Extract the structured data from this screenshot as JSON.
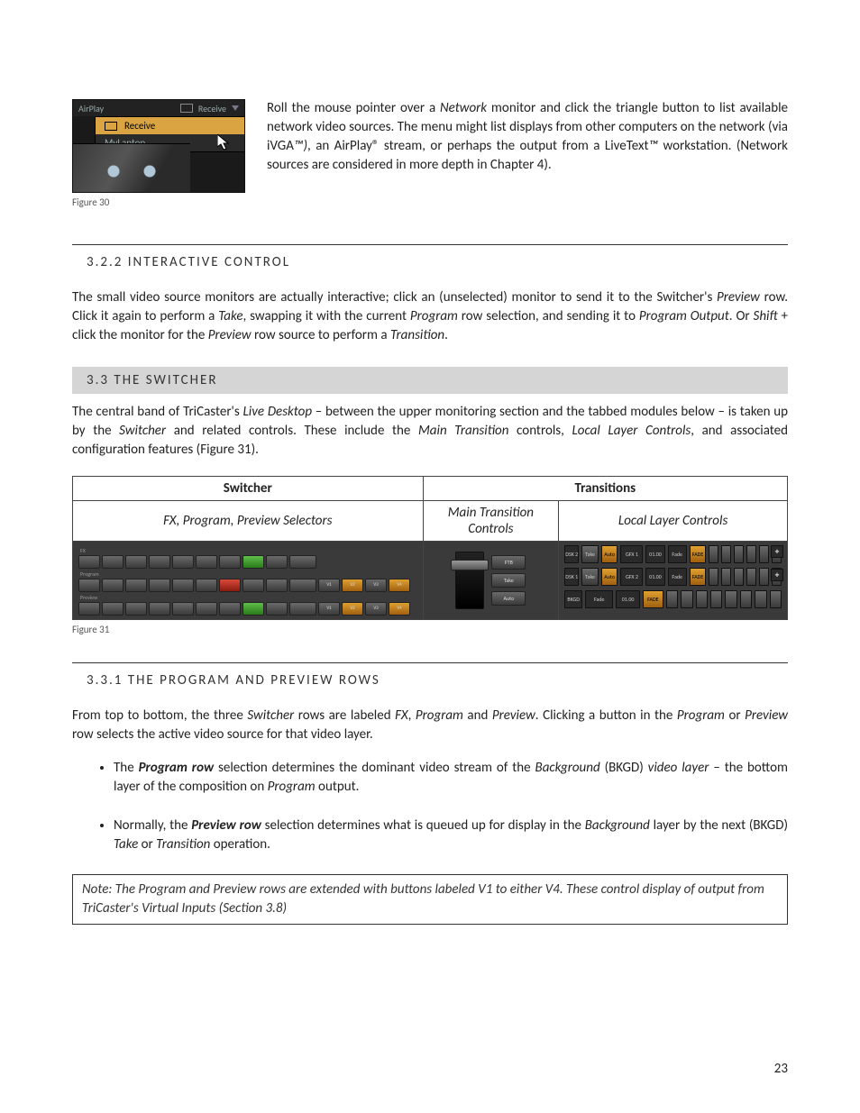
{
  "page_number": "23",
  "fig30": {
    "caption": "Figure 30",
    "header_left": "AirPlay",
    "header_right_label": "Receive",
    "menu_items": [
      "Receive",
      "MyLaptop"
    ]
  },
  "para_fig30": {
    "t0": "Roll the mouse pointer over a ",
    "i0": "Network",
    "t1": " monitor and ",
    "i1": "c",
    "t2": "lick the triangle button to list available network video sources.  The menu might list displays from other computers on the network (via iVGA",
    "i2": "™)",
    "t3": ", an AirPlay® stream, or perhaps the output from a LiveText",
    "i3": "™",
    "t4": " workstation. (Network sources are considered in more depth in Chapter 4)."
  },
  "heading_322": "3.2.2   INTERACTIVE CONTROL",
  "para_322": {
    "t0": "The small video source monitors are actually interactive; click an (unselected) monitor to send it to the Switcher's ",
    "i0": "Preview",
    "t1": " row.  Click it again to perform a ",
    "i1": "Take",
    "t2": ", swapping it with the current ",
    "i2": "Program",
    "t3": " row selection, and sending it to ",
    "i3": "Program Output",
    "t4": ". Or ",
    "i4": "Shift",
    "t5": " + click the monitor for the ",
    "i5": "Preview",
    "t6": " row source to perform a ",
    "i6": "Transition",
    "t7": "."
  },
  "heading_33": "3.3    THE SWITCHER",
  "para_33": {
    "t0": "The central band of TriCaster's ",
    "i0": "Live Desktop",
    "t1": " – between the upper monitoring section and the tabbed modules below – is taken up by the ",
    "i1": "Switcher",
    "t2": " and related controls. These include the ",
    "i2": "Main Transition",
    "t3": " controls, ",
    "i3": "Local Layer Controls",
    "t4": ", and associated configuration features (Figure 31)."
  },
  "f31": {
    "caption": "Figure 31",
    "col_switcher": "Switcher",
    "col_transitions": "Transitions",
    "sub_left": "FX, Program, Preview Selectors",
    "sub_mid": "Main Transition Controls",
    "sub_right": "Local Layer Controls",
    "sw_labels": [
      "FX",
      "Program",
      "Preview"
    ],
    "tbtn_ftb": "FTB",
    "tbtn_take": "Take",
    "tbtn_auto": "Auto",
    "layer_rows": [
      {
        "name": "DSK 2",
        "btn1": "Take",
        "btn2": "Auto",
        "sel": "GFX 1",
        "time": "01.00",
        "mode": "Fade",
        "maction": "FADE"
      },
      {
        "name": "DSK 1",
        "btn1": "Take",
        "btn2": "Auto",
        "sel": "GFX 2",
        "time": "01.00",
        "mode": "Fade",
        "maction": "FADE"
      },
      {
        "name": "BKGD",
        "btn1": "",
        "btn2": "",
        "sel": "Fade",
        "time": "01.00",
        "mode": "",
        "maction": "FADE"
      }
    ],
    "v_labels": [
      "V1",
      "V2",
      "V3",
      "V4"
    ]
  },
  "heading_331": "3.3.1   THE PROGRAM AND PREVIEW ROWS",
  "para_331": {
    "t0": "From top to bottom, the three ",
    "i0": "Switcher",
    "t1": " rows are labeled ",
    "i1": "FX",
    "t2": ", ",
    "i2": "Program",
    "t3": " and ",
    "i3": "Preview",
    "t4": ".  Clicking a button in the ",
    "i4": "Program",
    "t5": " or ",
    "i5": "Preview",
    "t6": " row selects the active video source for that video layer."
  },
  "bullets": [
    {
      "t0": "The ",
      "b0": "Program row",
      "t1": " selection determines the dominant video stream of the ",
      "i0": "Background",
      "t2": " (BKGD) ",
      "i1": "video layer",
      "t3": " – the bottom layer of the composition on ",
      "i2": "Program",
      "t4": " output."
    },
    {
      "t0": "Normally, the ",
      "b0": "Preview row",
      "t1": " selection determines what is queued up for display in the ",
      "i0": "Background",
      "t2": " layer by the next (BKGD) ",
      "i1": "Take",
      "t3": " or ",
      "i2": "Transition",
      "t4": " operation."
    }
  ],
  "note": "Note: The Program and Preview rows are extended with buttons labeled V1 to either V4.  These control display of output from TriCaster's Virtual Inputs (Section 3.8)"
}
